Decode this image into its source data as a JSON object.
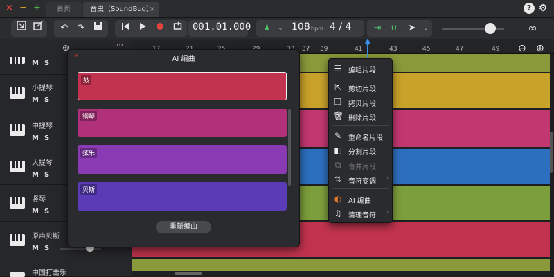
{
  "window": {
    "close": "×",
    "minimize": "−",
    "zoom": "+",
    "tabs": [
      {
        "label": "首页"
      },
      {
        "label": "音虫（SoundBug）",
        "close": "×"
      }
    ],
    "help": "?",
    "settings": "⚙"
  },
  "toolbar": {
    "position": "001.01.000",
    "tempo": "108",
    "bpm_label": "bpm",
    "time_signature": "4 / 4"
  },
  "ruler": {
    "ticks": [
      "17",
      "21",
      "25",
      "29",
      "33",
      "37",
      "39",
      "41",
      "43",
      "45",
      "47",
      "49"
    ]
  },
  "tracks": [
    {
      "name": "",
      "ms": "MS"
    },
    {
      "name": "小提琴",
      "ms": "MS"
    },
    {
      "name": "中提琴",
      "ms": "MS"
    },
    {
      "name": "大提琴",
      "ms": "MS"
    },
    {
      "name": "竖琴",
      "ms": "MS"
    },
    {
      "name": "原声贝斯",
      "ms": "MS"
    },
    {
      "name": "中国打击乐",
      "ms": ""
    }
  ],
  "dialog": {
    "title": "AI 编曲",
    "close": "×",
    "parts": [
      {
        "label": "鼓",
        "color": "#c2334f"
      },
      {
        "label": "钢琴",
        "color": "#b0307a"
      },
      {
        "label": "弦乐",
        "color": "#8a3bb4"
      },
      {
        "label": "贝斯",
        "color": "#5b3bb6"
      }
    ],
    "regenerate": "重新编曲"
  },
  "context_menu": {
    "items": [
      {
        "icon": "☰",
        "label": "编辑片段"
      },
      {
        "icon": "⇱",
        "label": "剪切片段"
      },
      {
        "icon": "❐",
        "label": "拷贝片段"
      },
      {
        "icon": "🗑",
        "label": "删除片段"
      },
      {
        "icon": "✎",
        "label": "重命名片段"
      },
      {
        "icon": "◧",
        "label": "分割片段"
      },
      {
        "icon": "⧉",
        "label": "合并片段"
      },
      {
        "icon": "⇅",
        "label": "音符变调",
        "arrow": "›"
      },
      {
        "icon": "◐",
        "label": "AI 编曲"
      },
      {
        "icon": "♫",
        "label": "清理音符",
        "arrow": "›"
      }
    ]
  },
  "lanes": [
    {
      "color": "#8a9a3a"
    },
    {
      "color": "#c9a22a"
    },
    {
      "color": "#c23770"
    },
    {
      "color": "#2d6fbf"
    },
    {
      "color": "#7d9e3c"
    },
    {
      "color": "#c2334f"
    },
    {
      "color": "#8a9a3a"
    }
  ]
}
